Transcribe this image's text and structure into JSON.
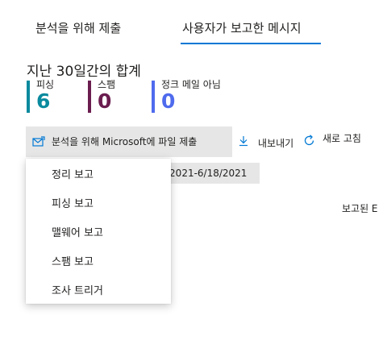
{
  "tabs": [
    {
      "label": "분석을 위해 제출",
      "selected": false
    },
    {
      "label": "사용자가 보고한 메시지",
      "selected": true
    }
  ],
  "summary": {
    "title": "지난 30일간의 합계",
    "stats": [
      {
        "label": "피싱",
        "value": "6",
        "color": "#0a8a9e"
      },
      {
        "label": "스팸",
        "value": "0",
        "color": "#6b1d4f"
      },
      {
        "label": "정크 메일 아님",
        "value": "0",
        "color": "#4f6bed"
      }
    ]
  },
  "toolbar": {
    "submit_label": "분석을 위해 Microsoft에 파일 제출",
    "submit_icon": "mail-submit-icon",
    "export_label": "내보내기",
    "export_icon": "download-icon",
    "refresh_label": "새로 고침",
    "refresh_icon": "refresh-icon"
  },
  "date_range": "/2021-6/18/2021",
  "table": {
    "column_reported": "보고된 E"
  },
  "menu": {
    "items": [
      {
        "label": "정리 보고"
      },
      {
        "label": "피싱 보고"
      },
      {
        "label": "맬웨어 보고"
      },
      {
        "label": "스팸 보고"
      },
      {
        "label": "조사 트리거"
      }
    ]
  },
  "colors": {
    "accent": "#0078d4",
    "button_bg": "#e6e6e6"
  }
}
